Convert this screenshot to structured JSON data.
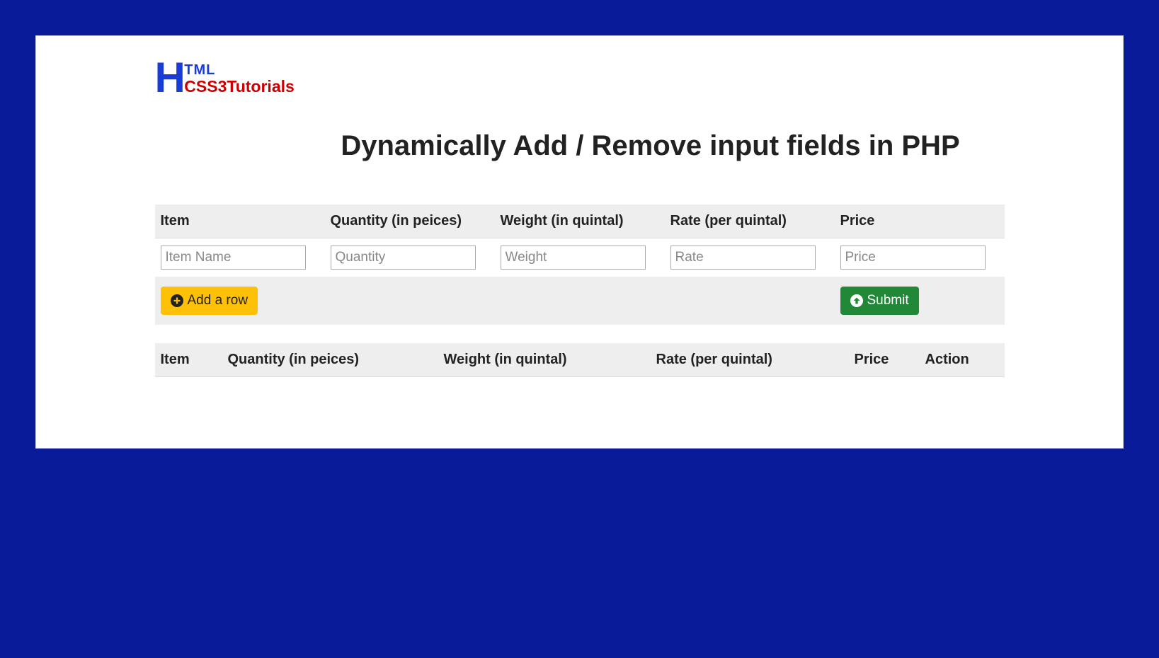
{
  "logo": {
    "h_letter": "H",
    "tml": "TML",
    "css3": "CSS3Tutorials"
  },
  "page": {
    "title": "Dynamically Add / Remove input fields in PHP"
  },
  "input_table": {
    "headers": {
      "item": "Item",
      "quantity": "Quantity (in peices)",
      "weight": "Weight (in quintal)",
      "rate": "Rate (per quintal)",
      "price": "Price"
    },
    "row": {
      "item": {
        "value": "",
        "placeholder": "Item Name"
      },
      "quantity": {
        "value": "",
        "placeholder": "Quantity"
      },
      "weight": {
        "value": "",
        "placeholder": "Weight"
      },
      "rate": {
        "value": "",
        "placeholder": "Rate"
      },
      "price": {
        "value": "",
        "placeholder": "Price"
      }
    },
    "buttons": {
      "add_row": "Add a row",
      "submit": "Submit"
    }
  },
  "results_table": {
    "headers": {
      "item": "Item",
      "quantity": "Quantity (in peices)",
      "weight": "Weight (in quintal)",
      "rate": "Rate (per quintal)",
      "price": "Price",
      "action": "Action"
    }
  }
}
